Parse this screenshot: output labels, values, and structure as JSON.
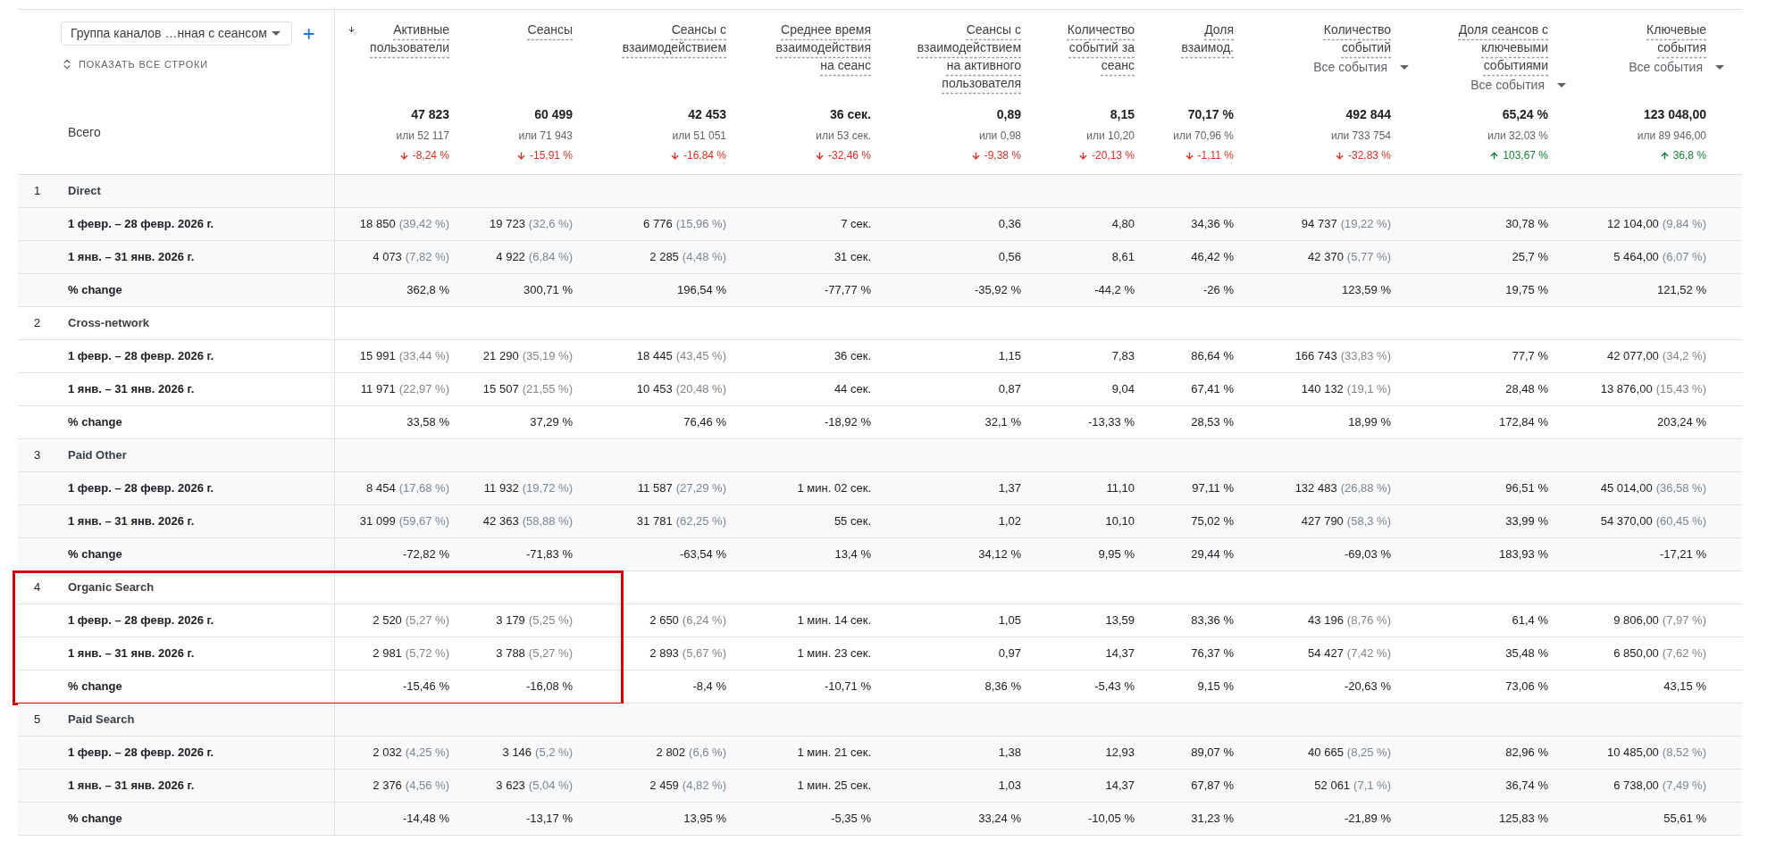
{
  "dimension_selector": {
    "value": "Группа каналов …нная с сеансом"
  },
  "show_all_rows": "ПОКАЗАТЬ ВСЕ СТРОКИ",
  "total_label": "Всего",
  "columns": [
    {
      "title": "Активные\nпользователи",
      "sorted": true,
      "total": "47 823",
      "total_compare": "или 52 117",
      "total_change": "-8,24 %",
      "increase": false
    },
    {
      "title": "Сеансы",
      "sorted": false,
      "total": "60 499",
      "total_compare": "или 71 943",
      "total_change": "-15,91 %",
      "increase": false
    },
    {
      "title": "Сеансы с\nвзаимодействием",
      "sorted": false,
      "total": "42 453",
      "total_compare": "или 51 051",
      "total_change": "-16,84 %",
      "increase": false
    },
    {
      "title": "Среднее время\nвзаимодействия\nна сеанс",
      "sorted": false,
      "total": "36 сек.",
      "total_compare": "или 53 сек.",
      "total_change": "-32,46 %",
      "increase": false
    },
    {
      "title": "Сеансы с\nвзаимодействием\nна активного\nпользователя",
      "sorted": false,
      "total": "0,89",
      "total_compare": "или 0,98",
      "total_change": "-9,38 %",
      "increase": false
    },
    {
      "title": "Количество\nсобытий за\nсеанс",
      "sorted": false,
      "total": "8,15",
      "total_compare": "или 10,20",
      "total_change": "-20,13 %",
      "increase": false
    },
    {
      "title": "Доля\nвзаимод.",
      "sorted": false,
      "total": "70,17 %",
      "total_compare": "или 70,96 %",
      "total_change": "-1,11 %",
      "increase": false
    },
    {
      "title": "Количество\nсобытий",
      "sorted": false,
      "filter": "Все события",
      "total": "492 844",
      "total_compare": "или 733 754",
      "total_change": "-32,83 %",
      "increase": false
    },
    {
      "title": "Доля сеансов с\nключевыми\nсобытиями",
      "sorted": false,
      "filter": "Все события",
      "total": "65,24 %",
      "total_compare": "или 32,03 %",
      "total_change": "103,67 %",
      "increase": true
    },
    {
      "title": "Ключевые\nсобытия",
      "sorted": false,
      "filter": "Все события",
      "total": "123 048,00",
      "total_compare": "или 89 946,00",
      "total_change": "36,8 %",
      "increase": true
    }
  ],
  "groups": [
    {
      "number": "1",
      "name": "Direct",
      "highlighted": false,
      "rows": [
        {
          "label": "1 февр. – 28 февр. 2026 г.",
          "cells": [
            [
              "18 850",
              "(39,42 %)"
            ],
            [
              "19 723",
              "(32,6 %)"
            ],
            [
              "6 776",
              "(15,96 %)"
            ],
            [
              "7 сек."
            ],
            [
              "0,36"
            ],
            [
              "4,80"
            ],
            [
              "34,36 %"
            ],
            [
              "94 737",
              "(19,22 %)"
            ],
            [
              "30,78 %"
            ],
            [
              "12 104,00",
              "(9,84 %)"
            ]
          ]
        },
        {
          "label": "1 янв. – 31 янв. 2026 г.",
          "cells": [
            [
              "4 073",
              "(7,82 %)"
            ],
            [
              "4 922",
              "(6,84 %)"
            ],
            [
              "2 285",
              "(4,48 %)"
            ],
            [
              "31 сек."
            ],
            [
              "0,56"
            ],
            [
              "8,61"
            ],
            [
              "46,42 %"
            ],
            [
              "42 370",
              "(5,77 %)"
            ],
            [
              "25,7 %"
            ],
            [
              "5 464,00",
              "(6,07 %)"
            ]
          ]
        },
        {
          "label": "% change",
          "cells": [
            [
              "362,8 %"
            ],
            [
              "300,71 %"
            ],
            [
              "196,54 %"
            ],
            [
              "-77,77 %"
            ],
            [
              "-35,92 %"
            ],
            [
              "-44,2 %"
            ],
            [
              "-26 %"
            ],
            [
              "123,59 %"
            ],
            [
              "19,75 %"
            ],
            [
              "121,52 %"
            ]
          ]
        }
      ]
    },
    {
      "number": "2",
      "name": "Cross-network",
      "highlighted": false,
      "rows": [
        {
          "label": "1 февр. – 28 февр. 2026 г.",
          "cells": [
            [
              "15 991",
              "(33,44 %)"
            ],
            [
              "21 290",
              "(35,19 %)"
            ],
            [
              "18 445",
              "(43,45 %)"
            ],
            [
              "36 сек."
            ],
            [
              "1,15"
            ],
            [
              "7,83"
            ],
            [
              "86,64 %"
            ],
            [
              "166 743",
              "(33,83 %)"
            ],
            [
              "77,7 %"
            ],
            [
              "42 077,00",
              "(34,2 %)"
            ]
          ]
        },
        {
          "label": "1 янв. – 31 янв. 2026 г.",
          "cells": [
            [
              "11 971",
              "(22,97 %)"
            ],
            [
              "15 507",
              "(21,55 %)"
            ],
            [
              "10 453",
              "(20,48 %)"
            ],
            [
              "44 сек."
            ],
            [
              "0,87"
            ],
            [
              "9,04"
            ],
            [
              "67,41 %"
            ],
            [
              "140 132",
              "(19,1 %)"
            ],
            [
              "28,48 %"
            ],
            [
              "13 876,00",
              "(15,43 %)"
            ]
          ]
        },
        {
          "label": "% change",
          "cells": [
            [
              "33,58 %"
            ],
            [
              "37,29 %"
            ],
            [
              "76,46 %"
            ],
            [
              "-18,92 %"
            ],
            [
              "32,1 %"
            ],
            [
              "-13,33 %"
            ],
            [
              "28,53 %"
            ],
            [
              "18,99 %"
            ],
            [
              "172,84 %"
            ],
            [
              "203,24 %"
            ]
          ]
        }
      ]
    },
    {
      "number": "3",
      "name": "Paid Other",
      "highlighted": false,
      "rows": [
        {
          "label": "1 февр. – 28 февр. 2026 г.",
          "cells": [
            [
              "8 454",
              "(17,68 %)"
            ],
            [
              "11 932",
              "(19,72 %)"
            ],
            [
              "11 587",
              "(27,29 %)"
            ],
            [
              "1 мин. 02 сек."
            ],
            [
              "1,37"
            ],
            [
              "11,10"
            ],
            [
              "97,11 %"
            ],
            [
              "132 483",
              "(26,88 %)"
            ],
            [
              "96,51 %"
            ],
            [
              "45 014,00",
              "(36,58 %)"
            ]
          ]
        },
        {
          "label": "1 янв. – 31 янв. 2026 г.",
          "cells": [
            [
              "31 099",
              "(59,67 %)"
            ],
            [
              "42 363",
              "(58,88 %)"
            ],
            [
              "31 781",
              "(62,25 %)"
            ],
            [
              "55 сек."
            ],
            [
              "1,02"
            ],
            [
              "10,10"
            ],
            [
              "75,02 %"
            ],
            [
              "427 790",
              "(58,3 %)"
            ],
            [
              "33,99 %"
            ],
            [
              "54 370,00",
              "(60,45 %)"
            ]
          ]
        },
        {
          "label": "% change",
          "cells": [
            [
              "-72,82 %"
            ],
            [
              "-71,83 %"
            ],
            [
              "-63,54 %"
            ],
            [
              "13,4 %"
            ],
            [
              "34,12 %"
            ],
            [
              "9,95 %"
            ],
            [
              "29,44 %"
            ],
            [
              "-69,03 %"
            ],
            [
              "183,93 %"
            ],
            [
              "-17,21 %"
            ]
          ]
        }
      ]
    },
    {
      "number": "4",
      "name": "Organic Search",
      "highlighted": true,
      "rows": [
        {
          "label": "1 февр. – 28 февр. 2026 г.",
          "cells": [
            [
              "2 520",
              "(5,27 %)"
            ],
            [
              "3 179",
              "(5,25 %)"
            ],
            [
              "2 650",
              "(6,24 %)"
            ],
            [
              "1 мин. 14 сек."
            ],
            [
              "1,05"
            ],
            [
              "13,59"
            ],
            [
              "83,36 %"
            ],
            [
              "43 196",
              "(8,76 %)"
            ],
            [
              "61,4 %"
            ],
            [
              "9 806,00",
              "(7,97 %)"
            ]
          ]
        },
        {
          "label": "1 янв. – 31 янв. 2026 г.",
          "cells": [
            [
              "2 981",
              "(5,72 %)"
            ],
            [
              "3 788",
              "(5,27 %)"
            ],
            [
              "2 893",
              "(5,67 %)"
            ],
            [
              "1 мин. 23 сек."
            ],
            [
              "0,97"
            ],
            [
              "14,37"
            ],
            [
              "76,37 %"
            ],
            [
              "54 427",
              "(7,42 %)"
            ],
            [
              "35,48 %"
            ],
            [
              "6 850,00",
              "(7,62 %)"
            ]
          ]
        },
        {
          "label": "% change",
          "cells": [
            [
              "-15,46 %"
            ],
            [
              "-16,08 %"
            ],
            [
              "-8,4 %"
            ],
            [
              "-10,71 %"
            ],
            [
              "8,36 %"
            ],
            [
              "-5,43 %"
            ],
            [
              "9,15 %"
            ],
            [
              "-20,63 %"
            ],
            [
              "73,06 %"
            ],
            [
              "43,15 %"
            ]
          ]
        }
      ]
    },
    {
      "number": "5",
      "name": "Paid Search",
      "highlighted": false,
      "rows": [
        {
          "label": "1 февр. – 28 февр. 2026 г.",
          "cells": [
            [
              "2 032",
              "(4,25 %)"
            ],
            [
              "3 146",
              "(5,2 %)"
            ],
            [
              "2 802",
              "(6,6 %)"
            ],
            [
              "1 мин. 21 сек."
            ],
            [
              "1,38"
            ],
            [
              "12,93"
            ],
            [
              "89,07 %"
            ],
            [
              "40 665",
              "(8,25 %)"
            ],
            [
              "82,96 %"
            ],
            [
              "10 485,00",
              "(8,52 %)"
            ]
          ]
        },
        {
          "label": "1 янв. – 31 янв. 2026 г.",
          "cells": [
            [
              "2 376",
              "(4,56 %)"
            ],
            [
              "3 623",
              "(5,04 %)"
            ],
            [
              "2 459",
              "(4,82 %)"
            ],
            [
              "1 мин. 25 сек."
            ],
            [
              "1,03"
            ],
            [
              "14,37"
            ],
            [
              "67,87 %"
            ],
            [
              "52 061",
              "(7,1 %)"
            ],
            [
              "36,74 %"
            ],
            [
              "6 738,00",
              "(7,49 %)"
            ]
          ]
        },
        {
          "label": "% change",
          "cells": [
            [
              "-14,48 %"
            ],
            [
              "-13,17 %"
            ],
            [
              "13,95 %"
            ],
            [
              "-5,35 %"
            ],
            [
              "33,24 %"
            ],
            [
              "-10,05 %"
            ],
            [
              "31,23 %"
            ],
            [
              "-21,89 %"
            ],
            [
              "125,83 %"
            ],
            [
              "55,61 %"
            ]
          ]
        }
      ]
    }
  ]
}
